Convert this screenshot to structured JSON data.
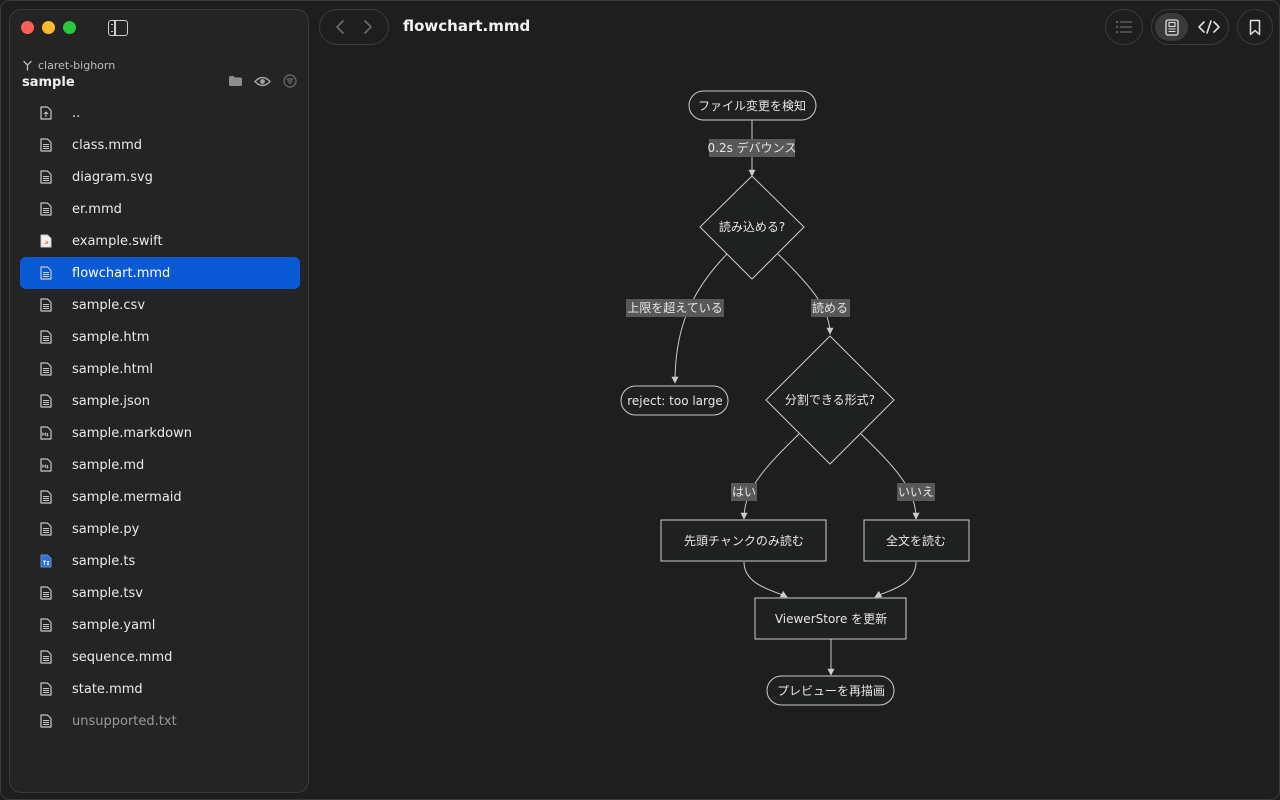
{
  "sidebar": {
    "branch": "claret-bighorn",
    "folder": "sample",
    "files": [
      {
        "name": "..",
        "icon": "parent-doc-icon"
      },
      {
        "name": "class.mmd",
        "icon": "doc-icon"
      },
      {
        "name": "diagram.svg",
        "icon": "doc-icon"
      },
      {
        "name": "er.mmd",
        "icon": "doc-icon"
      },
      {
        "name": "example.swift",
        "icon": "swift-doc-icon"
      },
      {
        "name": "flowchart.mmd",
        "icon": "doc-icon",
        "selected": true
      },
      {
        "name": "sample.csv",
        "icon": "doc-icon"
      },
      {
        "name": "sample.htm",
        "icon": "doc-icon"
      },
      {
        "name": "sample.html",
        "icon": "doc-icon"
      },
      {
        "name": "sample.json",
        "icon": "doc-icon"
      },
      {
        "name": "sample.markdown",
        "icon": "markdown-doc-icon"
      },
      {
        "name": "sample.md",
        "icon": "markdown-doc-icon"
      },
      {
        "name": "sample.mermaid",
        "icon": "doc-icon"
      },
      {
        "name": "sample.py",
        "icon": "doc-icon"
      },
      {
        "name": "sample.ts",
        "icon": "ts-doc-icon"
      },
      {
        "name": "sample.tsv",
        "icon": "doc-icon"
      },
      {
        "name": "sample.yaml",
        "icon": "doc-icon"
      },
      {
        "name": "sequence.mmd",
        "icon": "doc-icon"
      },
      {
        "name": "state.mmd",
        "icon": "doc-icon"
      },
      {
        "name": "unsupported.txt",
        "icon": "doc-icon",
        "dim": true
      }
    ]
  },
  "toolbar": {
    "title": "flowchart.mmd"
  },
  "diagram": {
    "nodes": {
      "start": "ファイル変更を検知",
      "read_check": "読み込める?",
      "reject": "reject: too large",
      "split_check": "分割できる形式?",
      "head_chunk": "先頭チャンクのみ読む",
      "full_read": "全文を読む",
      "update_store": "ViewerStore を更新",
      "redraw": "プレビューを再描画"
    },
    "edges": {
      "debounce": "0.2s デバウンス",
      "over_limit": "上限を超えている",
      "readable": "読める",
      "yes": "はい",
      "no": "いいえ"
    }
  },
  "colors": {
    "background": "#1e1e1e",
    "sidebar": "#242424",
    "selection": "#0a5ad6",
    "node_fill": "#1f2020",
    "node_stroke": "#cccccc",
    "edge_label_bg": "#585858"
  }
}
